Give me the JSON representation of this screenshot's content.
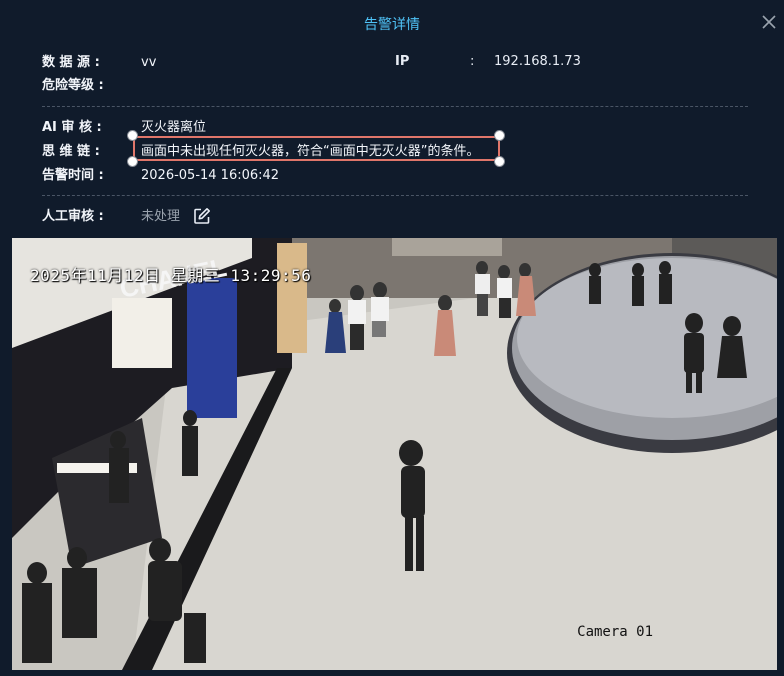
{
  "dialog": {
    "title": "告警详情",
    "close_icon": "close-icon"
  },
  "info": {
    "data_source_label": "数 据 源 :",
    "data_source_value": "vv",
    "ip_label": "IP",
    "ip_colon": ":",
    "ip_value": "192.168.1.73",
    "risk_level_label": "危险等级 :",
    "risk_level_value": ""
  },
  "ai_review": {
    "ai_label": "AI 审 核 :",
    "ai_value": "灭火器离位",
    "reasoning_label": "思 维 链 :",
    "reasoning_value": "画面中未出现任何灭火器，符合“画面中无灭火器”的条件。",
    "alarm_time_label": "告警时间 :",
    "alarm_time_value": "2026-05-14 16:06:42"
  },
  "manual_review": {
    "label": "人工审核 :",
    "status": "未处理",
    "edit_icon": "edit-icon"
  },
  "snapshot": {
    "osd_time": "2025年11月12日 星期三 13:29:56",
    "camera_label": "Camera 01",
    "store_sign": "CHANEL"
  },
  "colors": {
    "title": "#4fc3f7",
    "background": "#101b2b",
    "selection_border": "#e0766a"
  }
}
